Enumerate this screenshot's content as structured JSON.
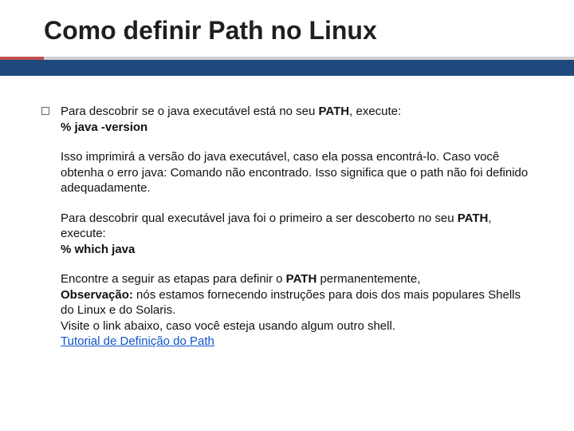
{
  "title": "Como definir Path no Linux",
  "p1_a": "Para descobrir se o java executável está no seu ",
  "p1_b": "PATH",
  "p1_c": ", execute:",
  "p1_cmd": "% java -version",
  "p2": "Isso imprimirá a versão do java executável, caso ela possa encontrá-lo. Caso você obtenha o erro java: Comando não encontrado. Isso significa que o path não foi definido adequadamente.",
  "p3_a": "Para descobrir qual executável java foi o primeiro a ser descoberto no seu ",
  "p3_b": "PATH",
  "p3_c": ", execute:",
  "p3_cmd": "% which java",
  "p4_a": "Encontre a seguir as etapas para definir o ",
  "p4_b": "PATH",
  "p4_c": " permanentemente,",
  "p4_obs_l": "Observação:",
  "p4_obs_t": " nós estamos fornecendo instruções para dois dos mais populares Shells do Linux e do Solaris.",
  "p4_vis": "Visite o link abaixo, caso você esteja usando algum outro shell.",
  "p4_link": "Tutorial de Definição do Path"
}
